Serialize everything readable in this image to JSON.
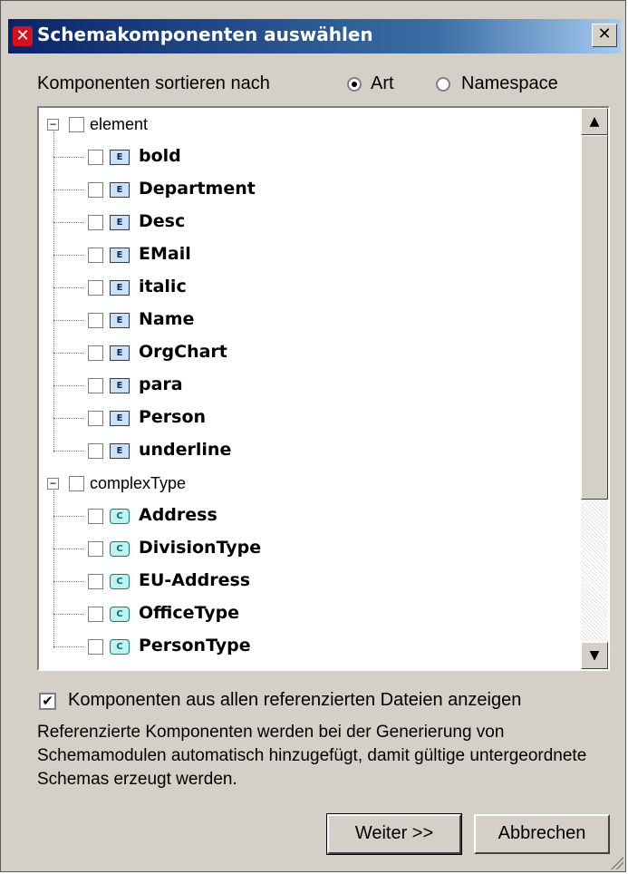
{
  "window": {
    "title": "Schemakomponenten auswählen",
    "close_glyph": "✕",
    "app_icon": "x-logo-icon"
  },
  "sort": {
    "label": "Komponenten sortieren nach",
    "options": [
      {
        "label": "Art",
        "checked": true
      },
      {
        "label": "Namespace",
        "checked": false
      }
    ]
  },
  "tree": {
    "groups": [
      {
        "label": "element",
        "expander": "−",
        "badge": "E",
        "items": [
          "bold",
          "Department",
          "Desc",
          "EMail",
          "italic",
          "Name",
          "OrgChart",
          "para",
          "Person",
          "underline"
        ]
      },
      {
        "label": "complexType",
        "expander": "−",
        "badge": "C",
        "items": [
          "Address",
          "DivisionType",
          "EU-Address",
          "OfficeType",
          "PersonType"
        ]
      }
    ],
    "scroll_up": "▲",
    "scroll_down": "▼"
  },
  "options": {
    "show_all_label": "Komponenten aus allen referenzierten Dateien anzeigen",
    "show_all_checked": true
  },
  "info": "Referenzierte Komponenten werden bei der Generierung von Schemamodulen automatisch hinzugefügt, damit gültige untergeordnete Schemas erzeugt werden.",
  "buttons": {
    "next": "Weiter >>",
    "cancel": "Abbrechen"
  }
}
